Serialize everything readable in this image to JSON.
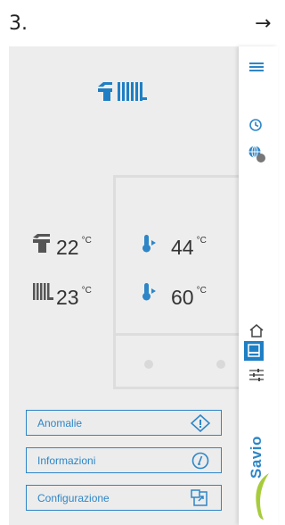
{
  "step": {
    "number": "3.",
    "arrow": "→"
  },
  "temperatures": {
    "tap_current": {
      "value": "22",
      "unit": "°C"
    },
    "radiator_current": {
      "value": "23",
      "unit": "°C"
    },
    "tap_setpoint": {
      "value": "44",
      "unit": "°C"
    },
    "radiator_setpoint": {
      "value": "60",
      "unit": "°C"
    }
  },
  "menu": {
    "anomalies": "Anomalie",
    "info": "Informazioni",
    "config": "Configurazione"
  },
  "brand": {
    "name": "Savio"
  },
  "icons": {
    "logo": "tap-radiator-icon",
    "hamburger": "menu-icon",
    "clock": "clock-icon",
    "globe": "globe-icon",
    "home": "home-icon",
    "panel": "panel-icon",
    "sliders": "sliders-icon",
    "warning": "warning-icon",
    "info": "info-icon",
    "config": "config-icon"
  },
  "colors": {
    "accent": "#2e86c7",
    "logo": "#1f7fc4",
    "brand_green": "#a7cc3b",
    "thermo_blue": "#2e86c7",
    "background": "#ededed"
  }
}
